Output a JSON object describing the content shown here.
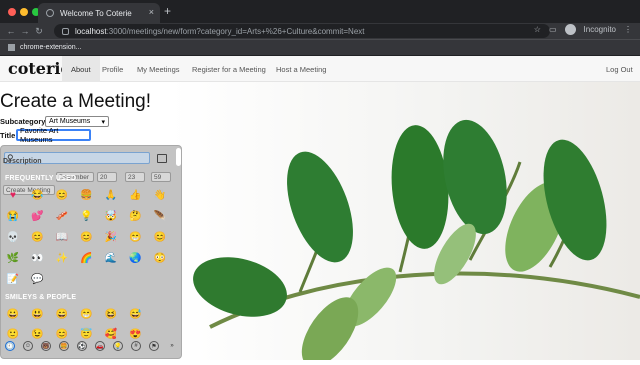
{
  "browser": {
    "tab_title": "Welcome To Coterie",
    "new_tab_glyph": "+",
    "close_glyph": "×",
    "url_host": "localhost",
    "url_path": ":3000/meetings/new/form?category_id=Arts+%26+Culture&commit=Next",
    "profile_label": "Incognito",
    "extension_label": "chrome-extension...",
    "back_glyph": "←",
    "forward_glyph": "→",
    "reload_glyph": "↻",
    "star_glyph": "☆",
    "menu_glyph": "⋮",
    "cast_glyph": "▭"
  },
  "nav": {
    "brand": "coterie",
    "items": [
      "About",
      "Profile",
      "My Meetings",
      "Register for a Meeting",
      "Host a Meeting"
    ],
    "active": "About",
    "logout": "Log Out"
  },
  "form": {
    "heading": "Create a Meeting!",
    "subcategory_label": "Subcategory",
    "subcategory_value": "Art Museums",
    "title_label": "Title",
    "title_value": "Favorite Art Museums",
    "description_label": "Description",
    "date_month": "December",
    "date_day": "20",
    "date_hour": "23",
    "date_minute": "59",
    "submit_label": "Create Meeting",
    "select_arrow": "▾"
  },
  "emoji_picker": {
    "search_glyph": "⚲",
    "frequently_used_label": "FREQUENTLY USED",
    "smileys_label": "SMILEYS & PEOPLE",
    "rows": [
      [
        "♥",
        "😂",
        "😊",
        "🍔",
        "🙏",
        "👍",
        "👋"
      ],
      [
        "😭",
        "💕",
        "🥓",
        "💡",
        "🤯",
        "🤔",
        "🪶"
      ],
      [
        "💀",
        "😊",
        "📖",
        "😊",
        "🎉",
        "😁",
        "😊"
      ],
      [
        "🌿",
        "👀",
        "✨",
        "🌈",
        "🌊",
        "🌏",
        "😳"
      ],
      [
        "📝",
        "💬"
      ],
      [
        "😀",
        "😃",
        "😄",
        "😁",
        "😆",
        "😅"
      ],
      [
        "🙂",
        "😉",
        "😊",
        "😇",
        "🥰",
        "😍"
      ]
    ],
    "category_icons": [
      "🕘",
      "☺",
      "🐻",
      "🍔",
      "⚽",
      "🚗",
      "💡",
      "#",
      "⚑",
      "»"
    ],
    "colors": {
      "accent": "#1e6ed0"
    }
  },
  "colors": {
    "focus": "#3b82f6",
    "nav_bg": "#f7f7f7"
  }
}
